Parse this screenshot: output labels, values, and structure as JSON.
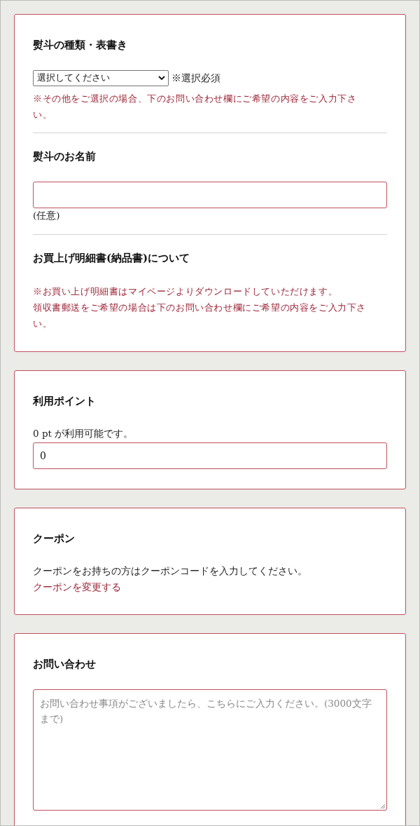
{
  "cards": [
    {
      "blocks": [
        {
          "kind": "heading",
          "text": "熨斗の種類・表書き"
        },
        {
          "kind": "select",
          "value": "選択してください",
          "suffix": "※選択必須"
        },
        {
          "kind": "note",
          "text": "※その他をご選択の場合、下のお問い合わせ欄にご希望の内容をご入力下さい。"
        },
        {
          "kind": "divider"
        },
        {
          "kind": "heading",
          "text": "熨斗のお名前"
        },
        {
          "kind": "input"
        },
        {
          "kind": "text",
          "text": "(任意)"
        },
        {
          "kind": "divider"
        },
        {
          "kind": "heading",
          "text": "お買上げ明細書(納品書)について"
        },
        {
          "kind": "note",
          "text": "※お買い上げ明細書はマイページよりダウンロードしていただけます。"
        },
        {
          "kind": "note",
          "text": "領収書郵送をご希望の場合は下のお問い合わせ欄にご希望の内容をご入力下さい。"
        }
      ]
    },
    {
      "blocks": [
        {
          "kind": "heading",
          "text": "利用ポイント"
        },
        {
          "kind": "text",
          "text": "0 pt が利用可能です。"
        },
        {
          "kind": "input",
          "value": "0"
        }
      ]
    },
    {
      "blocks": [
        {
          "kind": "heading",
          "text": "クーポン"
        },
        {
          "kind": "text",
          "text": "クーポンをお持ちの方はクーポンコードを入力してください。"
        },
        {
          "kind": "link",
          "text": "クーポンを変更する"
        }
      ]
    },
    {
      "blocks": [
        {
          "kind": "heading",
          "text": "お問い合わせ"
        },
        {
          "kind": "textarea",
          "placeholder": "お問い合わせ事項がございましたら、こちらにご入力ください。(3000文字まで)"
        }
      ]
    }
  ]
}
